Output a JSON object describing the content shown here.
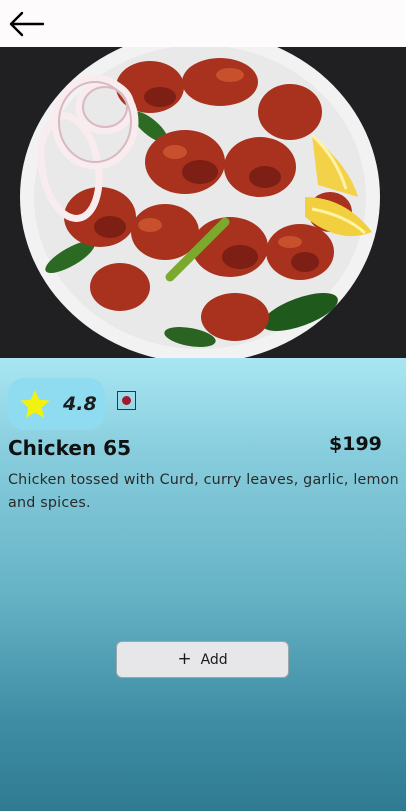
{
  "nav": {
    "back_icon": "arrow-left-icon"
  },
  "hero": {
    "image": "chicken-65-dish-photo"
  },
  "item": {
    "rating": "4.8",
    "rating_icon": "star-icon",
    "diet_icon": "non-veg-indicator-icon",
    "name": "Chicken 65",
    "price": "$199",
    "description": "Chicken tossed with Curd, curry leaves, garlic, lemon and spices."
  },
  "actions": {
    "add_icon": "+",
    "add_label": "Add"
  },
  "colors": {
    "rating_pill": "#8fdcf0",
    "star": "#f2f20f",
    "non_veg_dot": "#a4182b",
    "gradient_top": "#a9e6f3",
    "gradient_bottom": "#2e7b92"
  }
}
